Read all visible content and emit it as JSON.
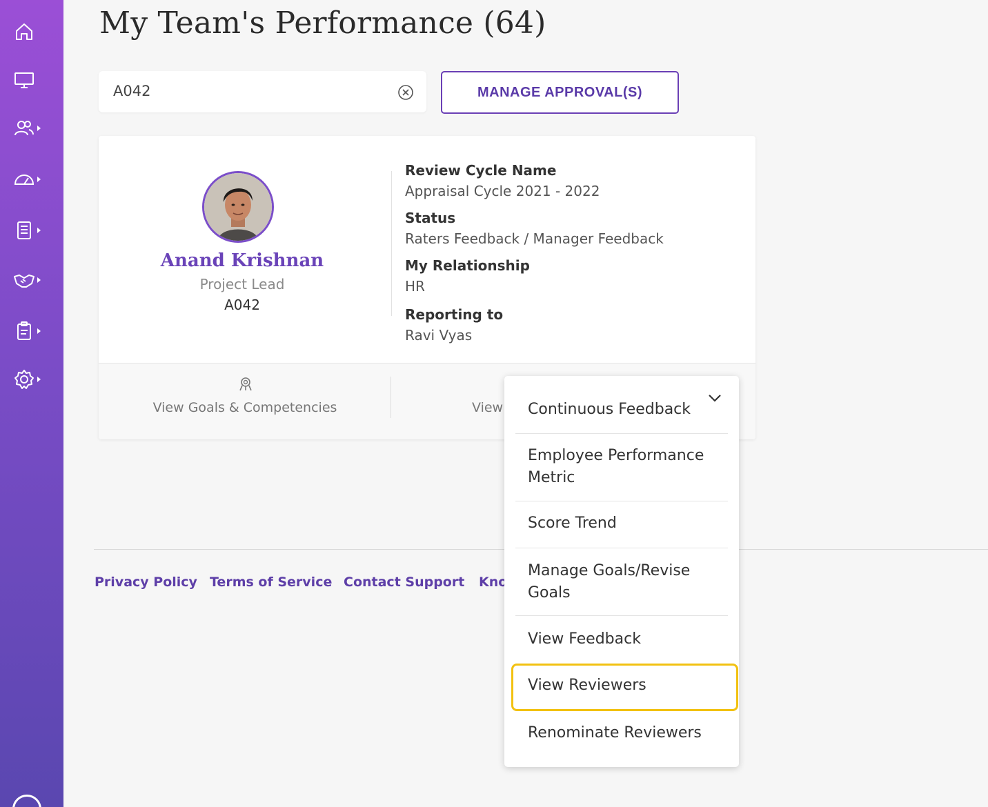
{
  "page": {
    "title": "My Team's Performance (64)"
  },
  "search": {
    "value": "A042"
  },
  "actions": {
    "manage_approvals": "MANAGE APPROVAL(S)"
  },
  "employee": {
    "name": "Anand Krishnan",
    "role": "Project Lead",
    "id": "A042"
  },
  "details": {
    "review_cycle_label": "Review Cycle Name",
    "review_cycle_value": "Appraisal Cycle 2021 - 2022",
    "status_label": "Status",
    "status_value": "Raters Feedback / Manager Feedback",
    "relationship_label": "My Relationship",
    "relationship_value": "HR",
    "reporting_label": "Reporting to",
    "reporting_value": "Ravi Vyas"
  },
  "card_footer": {
    "goals_link": "View Goals & Competencies",
    "view_partial": "View"
  },
  "menu": {
    "items": [
      "Continuous Feedback",
      "Employee Performance Metric",
      "Score Trend",
      "Manage Goals/Revise Goals",
      "View Feedback",
      "View Reviewers",
      "Renominate Reviewers"
    ],
    "highlighted": "View Reviewers"
  },
  "footer": {
    "links": [
      "Privacy Policy",
      "Terms of Service",
      "Contact Support",
      "Kno"
    ]
  },
  "colors": {
    "brand": "#6a43b8",
    "sidebar_top": "#9b4fd6",
    "sidebar_bottom": "#5a47b0",
    "highlight": "#f2c111"
  },
  "icons": [
    "home-icon",
    "monitor-icon",
    "team-icon",
    "dashboard-icon",
    "document-icon",
    "handshake-icon",
    "clipboard-icon",
    "settings-icon",
    "clear-icon",
    "goals-icon",
    "chevron-down-icon"
  ]
}
